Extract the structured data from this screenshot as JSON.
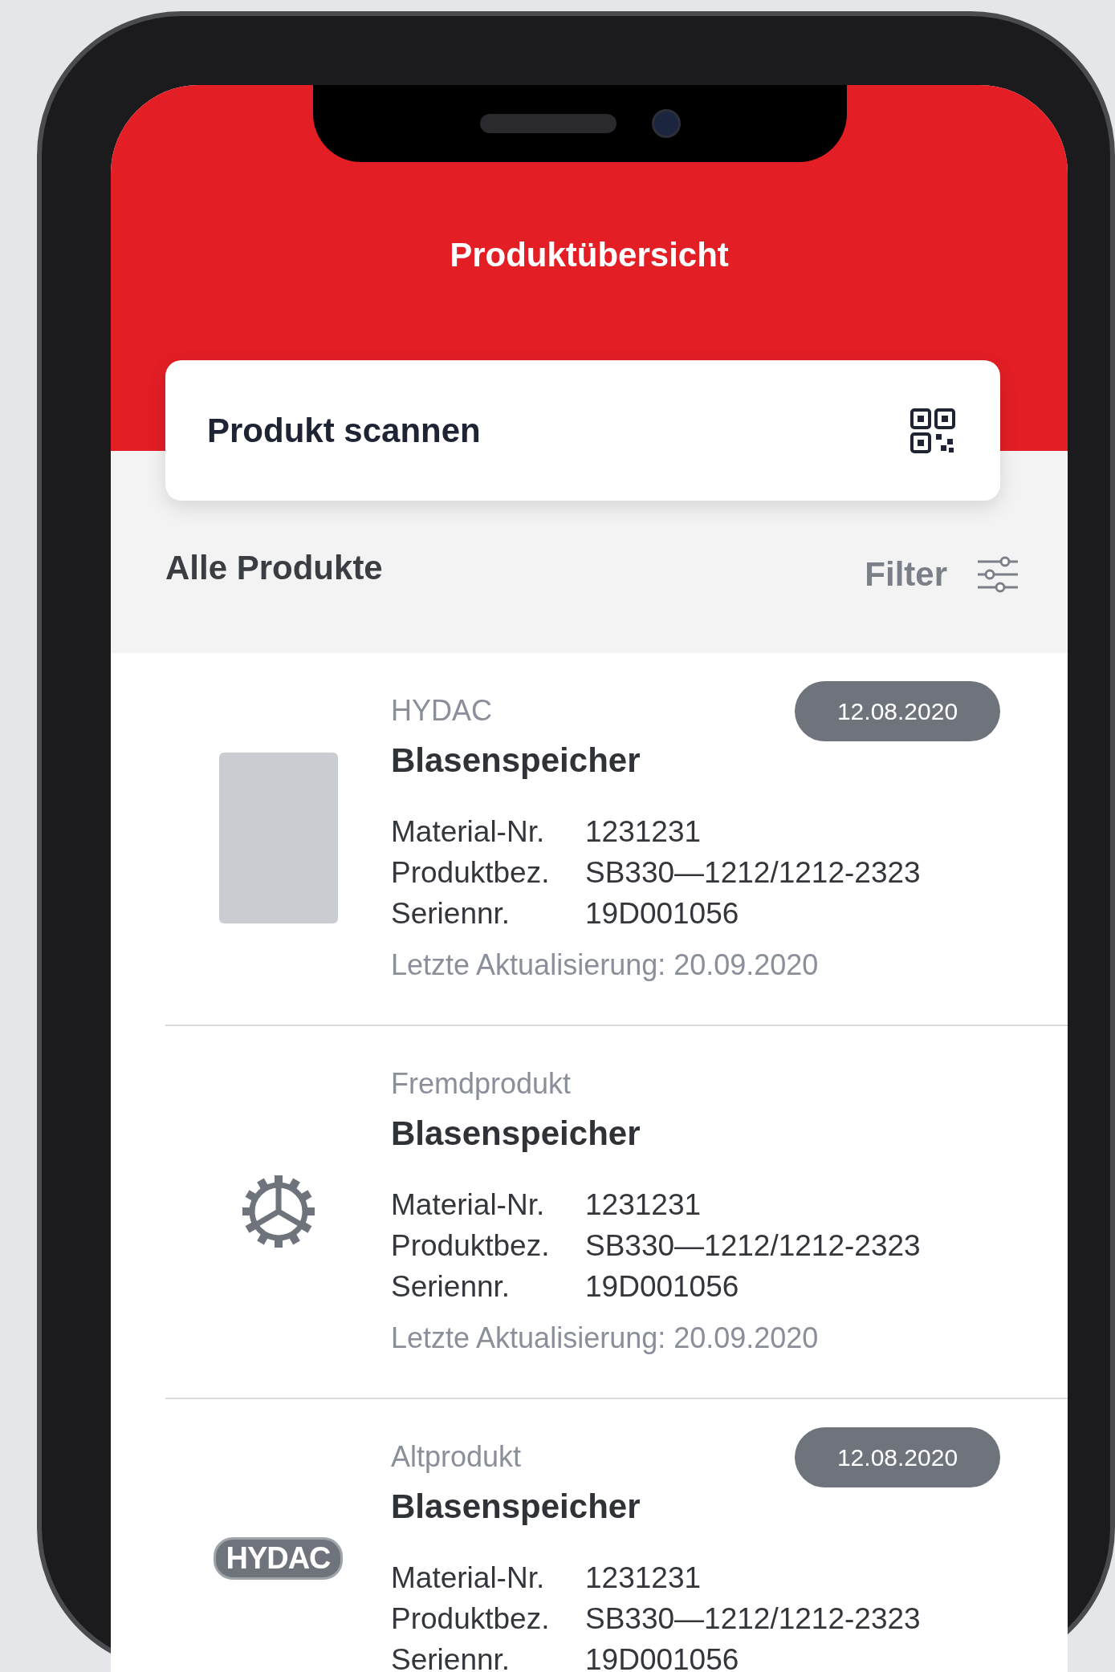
{
  "header": {
    "title": "Produktübersicht"
  },
  "scan_card": {
    "label": "Produkt scannen"
  },
  "list_header": {
    "title": "Alle Produkte",
    "filter_label": "Filter"
  },
  "products": [
    {
      "kind": "photo",
      "brand": "HYDAC",
      "badge": "12.08.2020",
      "name": "Blasenspeicher",
      "fields": [
        {
          "label": "Material-Nr.",
          "value": "1231231"
        },
        {
          "label": "Produktbez.",
          "value": "SB330—1212/1212-2323"
        },
        {
          "label": "Seriennr.",
          "value": "19D001056"
        }
      ],
      "updated": "Letzte Aktualisierung: 20.09.2020"
    },
    {
      "kind": "gear",
      "brand": "Fremdprodukt",
      "name": "Blasenspeicher",
      "fields": [
        {
          "label": "Material-Nr.",
          "value": "1231231"
        },
        {
          "label": "Produktbez.",
          "value": "SB330—1212/1212-2323"
        },
        {
          "label": "Seriennr.",
          "value": "19D001056"
        }
      ],
      "updated": "Letzte Aktualisierung: 20.09.2020"
    },
    {
      "kind": "logo",
      "logo_text": "HYDAC",
      "brand": "Altprodukt",
      "badge": "12.08.2020",
      "name": "Blasenspeicher",
      "fields": [
        {
          "label": "Material-Nr.",
          "value": "1231231"
        },
        {
          "label": "Produktbez.",
          "value": "SB330—1212/1212-2323"
        },
        {
          "label": "Seriennr.",
          "value": "19D001056"
        }
      ]
    }
  ]
}
